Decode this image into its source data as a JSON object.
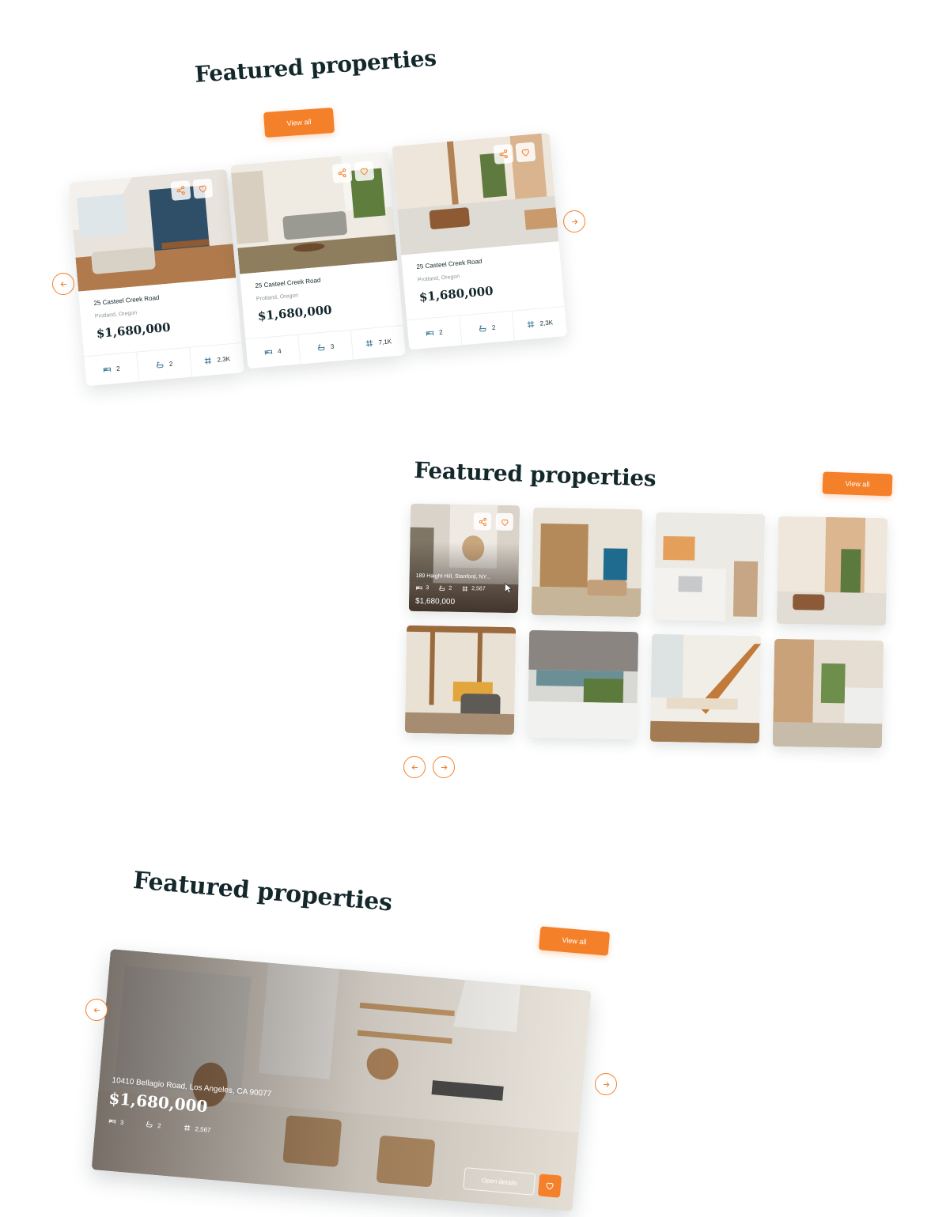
{
  "colors": {
    "accent": "#f5802a",
    "heading": "#14282c",
    "muted": "#8a9598"
  },
  "section1": {
    "title": "Featured properties",
    "view_all": "View all",
    "cards": [
      {
        "address": "25 Casteel Creek Road",
        "city": "Protland, Oregon",
        "price": "$1,680,000",
        "beds": "2",
        "baths": "2",
        "area": "2,3K"
      },
      {
        "address": "25 Casteel Creek Road",
        "city": "Protland, Oregon",
        "price": "$1,680,000",
        "beds": "4",
        "baths": "3",
        "area": "7,1K"
      },
      {
        "address": "25 Casteel Creek Road",
        "city": "Protland, Oregon",
        "price": "$1,680,000",
        "beds": "2",
        "baths": "2",
        "area": "2,3K"
      }
    ]
  },
  "section2": {
    "title": "Featured properties",
    "view_all": "View all",
    "featured_tile": {
      "address": "189 Haight Hill, Stanford, NY...",
      "beds": "3",
      "baths": "2",
      "area": "2,567",
      "price": "$1,680,000"
    }
  },
  "section3": {
    "title": "Featured properties",
    "view_all": "View all",
    "hero": {
      "address": "10410 Bellagio Road, Los Angeles, CA 90077",
      "price": "$1,680,000",
      "beds": "3",
      "baths": "2",
      "area": "2,567",
      "open_details": "Open details"
    }
  },
  "icons": [
    "share-icon",
    "heart-icon",
    "bed-icon",
    "bath-icon",
    "area-icon",
    "arrow-left-icon",
    "arrow-right-icon",
    "cursor-icon"
  ]
}
